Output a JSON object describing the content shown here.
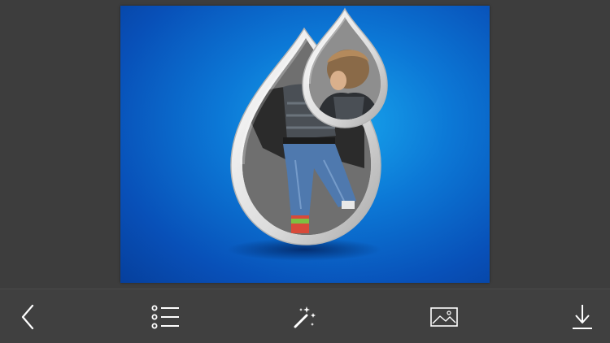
{
  "editor": {
    "frame_style": "water-drop",
    "background_color": "#0a6fd0"
  },
  "toolbar": {
    "buttons": [
      {
        "id": "back",
        "icon": "chevron-left-icon"
      },
      {
        "id": "frames",
        "icon": "list-icon"
      },
      {
        "id": "effects",
        "icon": "magic-wand-icon"
      },
      {
        "id": "gallery",
        "icon": "image-icon"
      },
      {
        "id": "save",
        "icon": "download-icon"
      }
    ],
    "icon_color": "#ffffff",
    "background_color": "#404040"
  }
}
